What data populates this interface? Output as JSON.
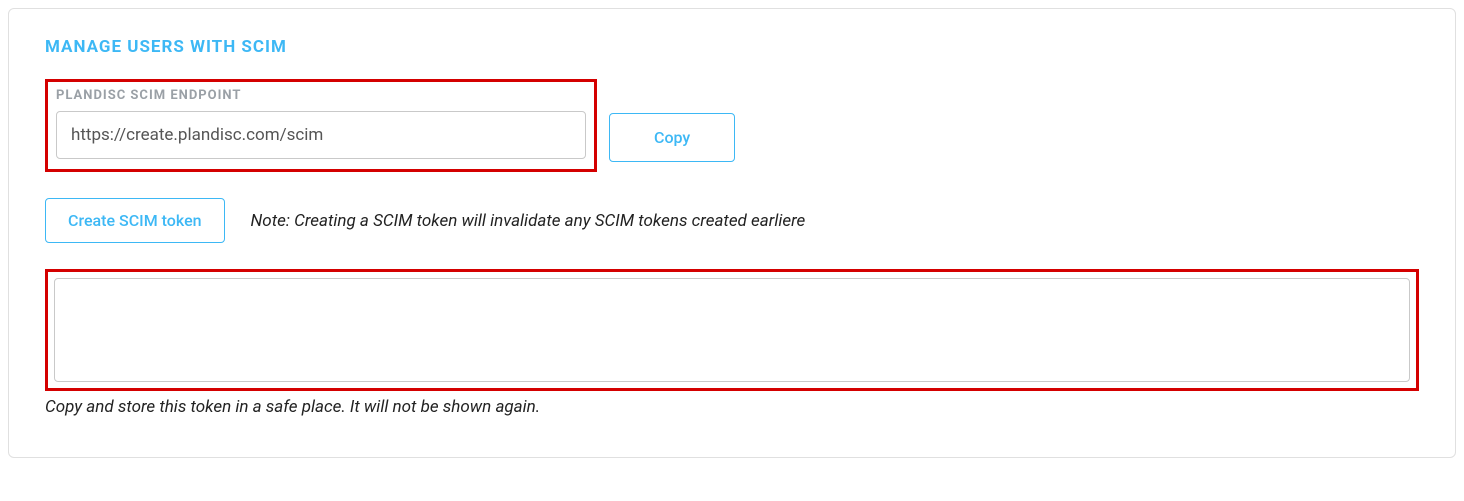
{
  "section": {
    "title": "MANAGE USERS WITH SCIM"
  },
  "endpoint": {
    "label": "PLANDISC SCIM ENDPOINT",
    "value": "https://create.plandisc.com/scim",
    "copy_label": "Copy"
  },
  "token": {
    "create_label": "Create SCIM token",
    "note": "Note: Creating a SCIM token will invalidate any SCIM tokens created earliere",
    "output": "",
    "hint": "Copy and store this token in a safe place. It will not be shown again."
  }
}
